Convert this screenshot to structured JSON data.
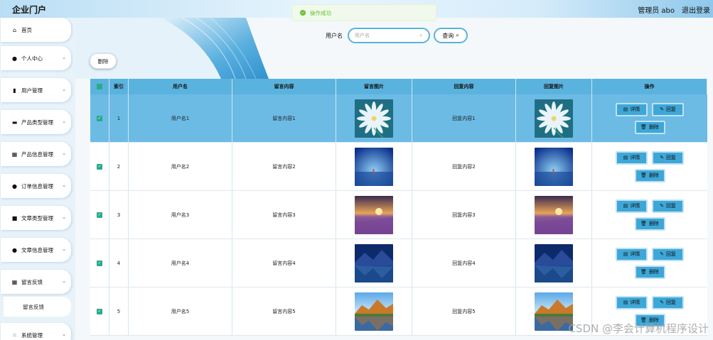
{
  "header": {
    "brand": "企业门户",
    "admin_label": "管理员 abo",
    "logout_label": "退出登录"
  },
  "toast": {
    "message": "操作成功"
  },
  "sidebar": {
    "items": [
      {
        "label": "首页",
        "icon": "home-icon"
      },
      {
        "label": "个人中心",
        "icon": "person-icon"
      },
      {
        "label": "用户管理",
        "icon": "chart-icon"
      },
      {
        "label": "产品类型管理",
        "icon": "briefcase-icon"
      },
      {
        "label": "产品信息管理",
        "icon": "grid-icon"
      },
      {
        "label": "订单信息管理",
        "icon": "person-icon"
      },
      {
        "label": "文章类型管理",
        "icon": "box-icon"
      },
      {
        "label": "文章信息管理",
        "icon": "person-icon"
      },
      {
        "label": "留言反馈",
        "icon": "grid-icon"
      },
      {
        "label": "系统管理",
        "icon": "apps-icon"
      }
    ],
    "submenu": {
      "label": "留言反馈"
    }
  },
  "search": {
    "label": "用户名",
    "placeholder": "用户名",
    "button": "查询"
  },
  "toolbar": {
    "delete_label": "删除"
  },
  "table": {
    "headers": [
      "索引",
      "用户名",
      "留言内容",
      "留言图片",
      "回复内容",
      "回复图片",
      "操作"
    ],
    "ops": {
      "detail": "详情",
      "reply": "回复",
      "remove": "删除"
    },
    "rows": [
      {
        "index": "1",
        "username": "用户名1",
        "message": "留言内容1",
        "reply": "回复内容1",
        "image": "flower"
      },
      {
        "index": "2",
        "username": "用户名2",
        "message": "留言内容2",
        "reply": "回复内容2",
        "image": "beach"
      },
      {
        "index": "3",
        "username": "用户名3",
        "message": "留言内容3",
        "reply": "回复内容3",
        "image": "lavender"
      },
      {
        "index": "4",
        "username": "用户名4",
        "message": "留言内容4",
        "reply": "回复内容4",
        "image": "mountain-lake"
      },
      {
        "index": "5",
        "username": "用户名5",
        "message": "留言内容5",
        "reply": "回复内容5",
        "image": "autumn-lake"
      }
    ]
  },
  "watermark": "CSDN @李会计算机程序设计",
  "colors": {
    "accent": "#5ab3de",
    "selected_row": "#6bbbe5",
    "checkbox": "#2aa98c",
    "success": "#67c23a"
  }
}
